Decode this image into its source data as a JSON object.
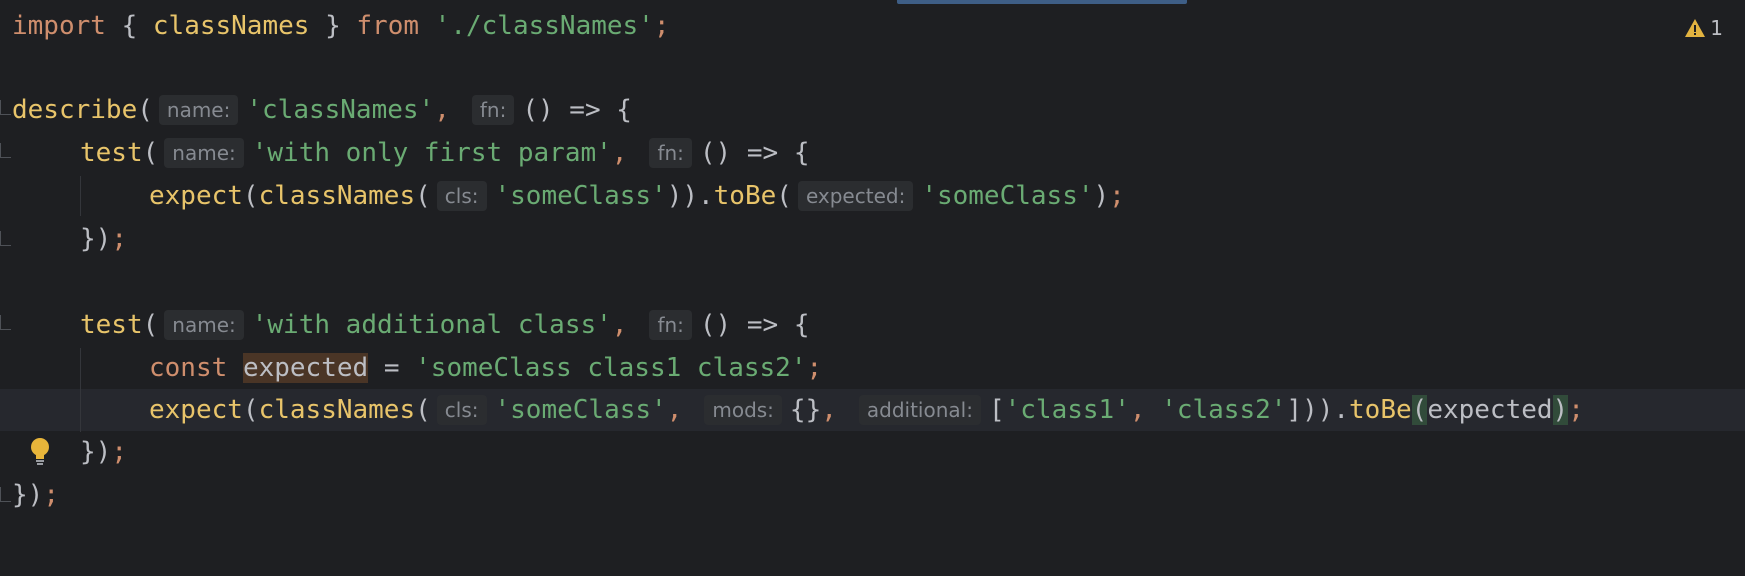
{
  "editor": {
    "warning_count": "1",
    "lines": {
      "l1": {
        "import": "import",
        "open": " { ",
        "name": "classNames",
        "close": " } ",
        "from": "from",
        "path": " './classNames'",
        "semi": ";"
      },
      "l3": {
        "describe": "describe",
        "open": "(",
        "hint_name": "name:",
        "name": "'classNames'",
        "comma": ",",
        "hint_fn": "fn:",
        "arrow": "() => {"
      },
      "l4": {
        "test": "test",
        "open": "(",
        "hint_name": "name:",
        "name": "'with only first param'",
        "comma": ",",
        "hint_fn": "fn:",
        "arrow": "() => {"
      },
      "l5": {
        "expect": "expect",
        "p1": "(",
        "classNames": "classNames",
        "p2": "(",
        "hint_cls": "cls:",
        "cls": "'someClass'",
        "p3": "))",
        "dot": ".",
        "toBe": "toBe",
        "p4": "(",
        "hint_expected": "expected:",
        "expected": "'someClass'",
        "p5": ")",
        "semi": ";"
      },
      "l6": {
        "close": "})",
        "semi": ";"
      },
      "l8": {
        "test": "test",
        "open": "(",
        "hint_name": "name:",
        "name": "'with additional class'",
        "comma": ",",
        "hint_fn": "fn:",
        "arrow": "() => {"
      },
      "l9": {
        "const": "const",
        "var": "expected",
        "eq": " = ",
        "value": "'someClass class1 class2'",
        "semi": ";"
      },
      "l10": {
        "expect": "expect",
        "p1": "(",
        "classNames": "classNames",
        "p2": "(",
        "hint_cls": "cls:",
        "cls": "'someClass'",
        "c1": ",",
        "hint_mods": "mods:",
        "mods": "{}",
        "c2": ",",
        "hint_additional": "additional:",
        "bopen": "[",
        "a1": "'class1'",
        "c3": ", ",
        "a2": "'class2'",
        "bclose": "]",
        "p3": "))",
        "dot": ".",
        "toBe": "toBe",
        "p4": "(",
        "arg": "expected",
        "p5": ")",
        "semi": ";"
      },
      "l11": {
        "close": "})",
        "semi": ";"
      },
      "l12": {
        "close": "})",
        "semi": ";"
      }
    }
  },
  "colors": {
    "background": "#1e1f22",
    "keyword": "#cf8e6d",
    "string": "#6aab73",
    "function": "#e8c46a",
    "warning": "#e2b340"
  }
}
